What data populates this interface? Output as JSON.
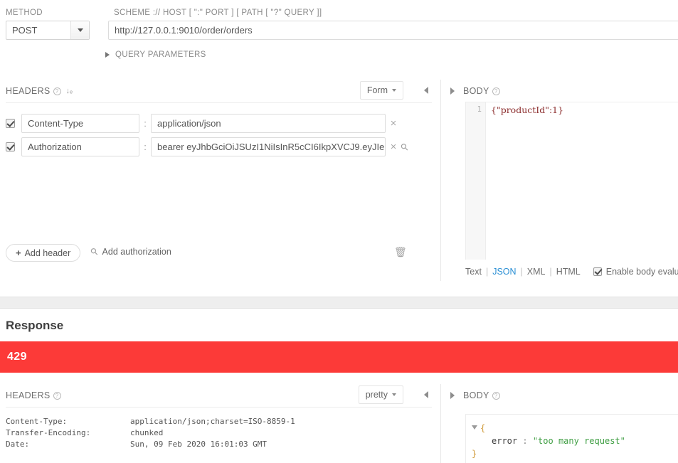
{
  "request": {
    "method_label": "METHOD",
    "method_value": "POST",
    "url_label": "SCHEME :// HOST [ \":\" PORT ] [ PATH [ \"?\" QUERY ]]",
    "url_value": "http://127.0.0.1:9010/order/orders",
    "query_parameters_label": "QUERY PARAMETERS",
    "headers": {
      "title": "HEADERS",
      "help_icon": "help-icon",
      "sort_icon": "sort-alpha-icon",
      "format_dropdown": "Form",
      "collapse_icon": "collapse-left-icon",
      "rows": [
        {
          "checked": true,
          "key": "Content-Type",
          "value": "application/json",
          "remove_label": "×",
          "has_key_icon": false
        },
        {
          "checked": true,
          "key": "Authorization",
          "value": "bearer eyJhbGciOiJSUzI1NiIsInR5cCI6IkpXVCJ9.eyJIe",
          "remove_label": "×",
          "has_key_icon": true
        }
      ],
      "colon": ":",
      "add_header_label": "Add header",
      "add_header_plus": "+",
      "add_authorization_label": "Add authorization",
      "delete_icon": "trash-icon"
    },
    "body": {
      "title": "BODY",
      "help_icon": "help-icon",
      "expand_icon": "expand-right-icon",
      "line_number": "1",
      "content": "{\"productId\":1}",
      "formats": [
        "Text",
        "JSON",
        "XML",
        "HTML"
      ],
      "active_format": "JSON",
      "separator": "|",
      "eval_checkbox_checked": true,
      "eval_label": "Enable body evalu"
    }
  },
  "response": {
    "title": "Response",
    "status_code": "429",
    "status_color": "#fc3a38",
    "headers": {
      "title": "HEADERS",
      "help_icon": "help-icon",
      "format_dropdown": "pretty",
      "collapse_icon": "collapse-left-icon",
      "rows": [
        {
          "name": "Content-Type:",
          "value": "application/json;charset=ISO-8859-1"
        },
        {
          "name": "Transfer-Encoding:",
          "value": "chunked"
        },
        {
          "name": "Date:",
          "value": "Sun, 09 Feb 2020 16:01:03 GMT"
        }
      ]
    },
    "body": {
      "title": "BODY",
      "help_icon": "help-icon",
      "expand_icon": "expand-right-icon",
      "open_brace": "{",
      "key": "error",
      "colon": ":",
      "value": "\"too many request\"",
      "close_brace": "}"
    }
  }
}
